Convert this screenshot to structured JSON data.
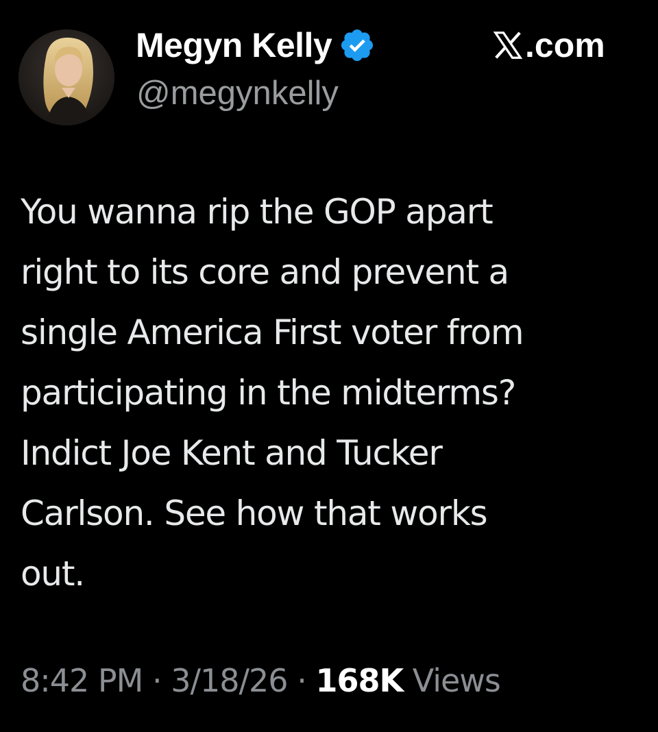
{
  "author": {
    "display_name": "Megyn Kelly",
    "handle": "@megynkelly",
    "verified_icon": "verified-badge-icon",
    "avatar_icon": "avatar-photo"
  },
  "brand": {
    "logo_icon": "x-logo-icon",
    "suffix": ".com"
  },
  "tweet": {
    "lines": [
      "You wanna rip the GOP apart",
      "right to its core and prevent a",
      "single America First voter from",
      "participating in the midterms?",
      "Indict Joe Kent and Tucker",
      "Carlson. See how that works",
      "out."
    ]
  },
  "meta": {
    "time": "8:42 PM",
    "separator": "·",
    "date": "3/18/26",
    "views_count": "168K",
    "views_label": "Views"
  },
  "colors": {
    "background": "#000000",
    "text": "#e7e9ea",
    "secondary": "#9a9d9f",
    "verified_blue": "#1d9bf0"
  }
}
